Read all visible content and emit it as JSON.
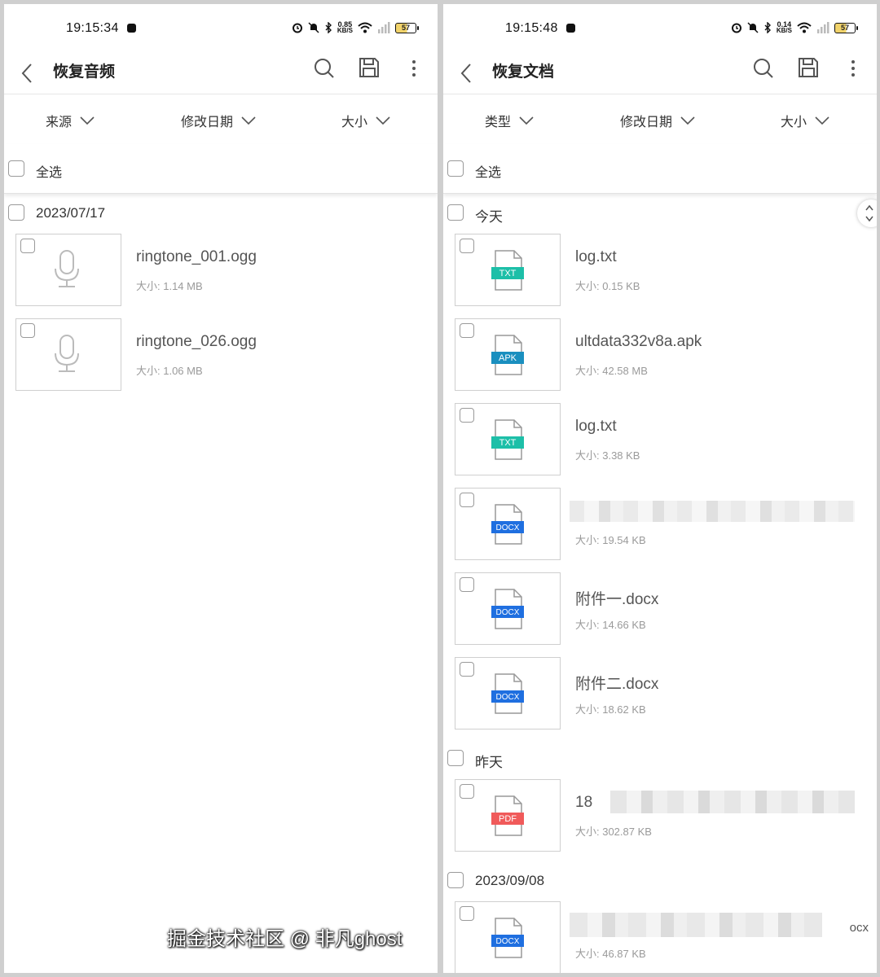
{
  "icons": {
    "back": "chevron-left-icon",
    "search": "search-icon",
    "save": "save-icon",
    "more": "more-vertical-icon",
    "dropdown": "chevron-down-icon",
    "mic": "microphone-icon",
    "doc": "document-icon"
  },
  "colors": {
    "txt": "#1dbfa8",
    "apk": "#1a8fbf",
    "docx": "#1f6fe0",
    "pdf": "#f05a5a"
  },
  "left": {
    "status": {
      "time": "19:15:34",
      "net_top": "0.85",
      "net_unit": "KB/S",
      "battery": "57"
    },
    "title": "恢复音频",
    "filters": [
      "来源",
      "修改日期",
      "大小"
    ],
    "select_all": "全选",
    "group_label": "2023/07/17",
    "files": [
      {
        "name": "ringtone_001.ogg",
        "size": "大小: 1.14 MB"
      },
      {
        "name": "ringtone_026.ogg",
        "size": "大小: 1.06 MB"
      }
    ]
  },
  "right": {
    "status": {
      "time": "19:15:48",
      "net_top": "0.14",
      "net_unit": "KB/S",
      "battery": "57"
    },
    "title": "恢复文档",
    "filters": [
      "类型",
      "修改日期",
      "大小"
    ],
    "select_all": "全选",
    "groups": {
      "today": "今天",
      "yesterday": "昨天",
      "date": "2023/09/08"
    },
    "files": [
      {
        "badge": "TXT",
        "name": "log.txt",
        "size": "大小: 0.15 KB"
      },
      {
        "badge": "APK",
        "name": "ultdata332v8a.apk",
        "size": "大小: 42.58 MB"
      },
      {
        "badge": "TXT",
        "name": "log.txt",
        "size": "大小: 3.38 KB"
      },
      {
        "badge": "DOCX",
        "name": "",
        "size": "大小: 19.54 KB"
      },
      {
        "badge": "DOCX",
        "name": "附件一.docx",
        "size": "大小: 14.66 KB"
      },
      {
        "badge": "DOCX",
        "name": "附件二.docx",
        "size": "大小: 18.62 KB"
      },
      {
        "badge": "PDF",
        "name": "18",
        "size": "大小: 302.87 KB"
      },
      {
        "badge": "DOCX",
        "name": "ocx",
        "size": "大小: 46.87 KB"
      }
    ]
  },
  "watermark": "掘金技术社区 @ 非凡ghost"
}
